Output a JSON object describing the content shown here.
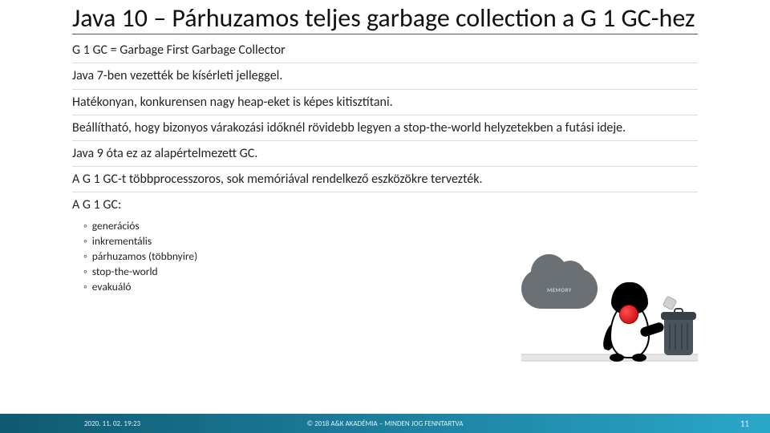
{
  "title": "Java 10 – Párhuzamos teljes garbage collection a G 1 GC-hez",
  "paragraphs": {
    "p0": "G 1 GC = Garbage First Garbage Collector",
    "p1": "Java 7-ben vezették be kísérleti jelleggel.",
    "p2": "Hatékonyan, konkurensen nagy heap-eket is képes kitisztítani.",
    "p3": "Beállítható, hogy bizonyos várakozási időknél rövidebb legyen a stop-the-world helyzetekben a futási ideje.",
    "p4": "Java 9 óta ez az alapértelmezett GC.",
    "p5": "A G 1 GC-t többprocesszoros, sok memóriával rendelkező eszközökre tervezték.",
    "p6": "A G 1 GC:"
  },
  "bullets": {
    "b0": "generációs",
    "b1": "inkrementális",
    "b2": "párhuzamos (többnyire)",
    "b3": "stop-the-world",
    "b4": "evakuáló"
  },
  "illustration": {
    "cloud_label": "MEMORY"
  },
  "footer": {
    "left": "2020. 11. 02. 19:23",
    "center": "© 2018 A&K AKADÉMIA – MINDEN JOG FENNTARTVA",
    "right": "11"
  }
}
